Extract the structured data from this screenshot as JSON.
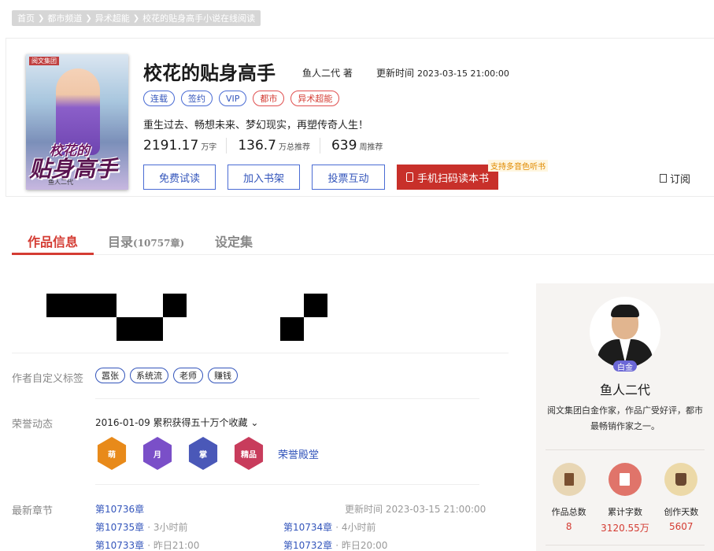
{
  "breadcrumb": [
    "首页",
    "都市频道",
    "异术超能",
    "校花的贴身高手小说在线阅读"
  ],
  "book": {
    "cover": {
      "publisher": "阅文集团",
      "title_small": "校花的",
      "title_big": "贴身高手",
      "author": "鱼人二代"
    },
    "title": "校花的贴身高手",
    "author": "鱼人二代 著",
    "update_label": "更新时间",
    "update_time": "2023-03-15 21:00:00",
    "tags": [
      {
        "text": "连载",
        "color": "blue"
      },
      {
        "text": "签约",
        "color": "blue"
      },
      {
        "text": "VIP",
        "color": "blue"
      },
      {
        "text": "都市",
        "color": "red"
      },
      {
        "text": "异术超能",
        "color": "red"
      }
    ],
    "intro": "重生过去、畅想未来、梦幻现实，再塑传奇人生！",
    "stats": [
      {
        "value": "2191.17",
        "unit": "万字"
      },
      {
        "value": "136.7",
        "unit": "万总推荐"
      },
      {
        "value": "639",
        "unit": "周推荐"
      }
    ],
    "buttons": {
      "read": "免费试读",
      "shelf": "加入书架",
      "vote": "投票互动",
      "scan": "手机扫码读本书"
    },
    "scan_tip": "支持多音色听书",
    "subscribe": "订阅"
  },
  "tabs": [
    {
      "label": "作品信息",
      "count": ""
    },
    {
      "label": "目录",
      "count": "(10757章)"
    },
    {
      "label": "设定集",
      "count": ""
    }
  ],
  "info": {
    "custom_tags_label": "作者自定义标签",
    "custom_tags": [
      "嚣张",
      "系统流",
      "老师",
      "赚钱"
    ],
    "honor_label": "荣誉动态",
    "honor_text": "2016-01-09  累积获得五十万个收藏 ⌄",
    "badges": [
      {
        "text": "萌",
        "color": "#e88a1a"
      },
      {
        "text": "月",
        "color": "#7a4fc8"
      },
      {
        "text": "掌",
        "color": "#4a58b8"
      },
      {
        "text": "精品",
        "color": "#c83c5c"
      }
    ],
    "honor_hall": "荣誉殿堂",
    "latest_label": "最新章节",
    "latest_chapter": "第10736章",
    "latest_update": "更新时间 2023-03-15 21:00:00",
    "chapters": [
      {
        "name": "第10735章",
        "time": "· 3小时前"
      },
      {
        "name": "第10734章",
        "time": "· 4小时前"
      },
      {
        "name": "第10733章",
        "time": "· 昨日21:00"
      },
      {
        "name": "第10732章",
        "time": "· 昨日20:00"
      }
    ]
  },
  "author_card": {
    "level": "白金",
    "name": "鱼人二代",
    "desc": "阅文集团白金作家，作品广受好评，都市最畅销作家之一。",
    "stats": [
      {
        "label": "作品总数",
        "value": "8",
        "icon": "book-icon",
        "color": "#e8d6b4"
      },
      {
        "label": "累计字数",
        "value": "3120.55万",
        "icon": "document-icon",
        "color": "#e0746a"
      },
      {
        "label": "创作天数",
        "value": "5607",
        "icon": "cup-icon",
        "color": "#ecd9a8"
      }
    ]
  }
}
